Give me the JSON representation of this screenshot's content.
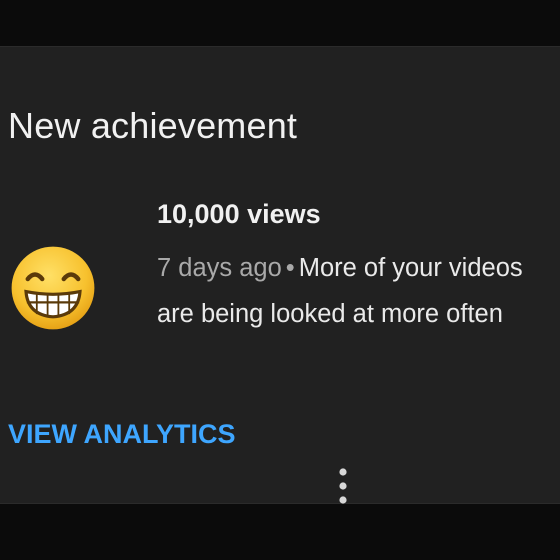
{
  "card": {
    "title": "New achievement",
    "icon": "grinning-face-emoji",
    "milestone": "10,000 views",
    "timestamp": "7 days ago",
    "separator": "•",
    "message": "More of your videos are being looked at more often",
    "action_label": "VIEW ANALYTICS",
    "menu_icon": "three-dot-vertical-icon"
  },
  "colors": {
    "background": "#212121",
    "text": "#f1f1f1",
    "secondary_text": "#a9a9a9",
    "link": "#3ea6ff",
    "emoji_face": "#f7c12e"
  }
}
